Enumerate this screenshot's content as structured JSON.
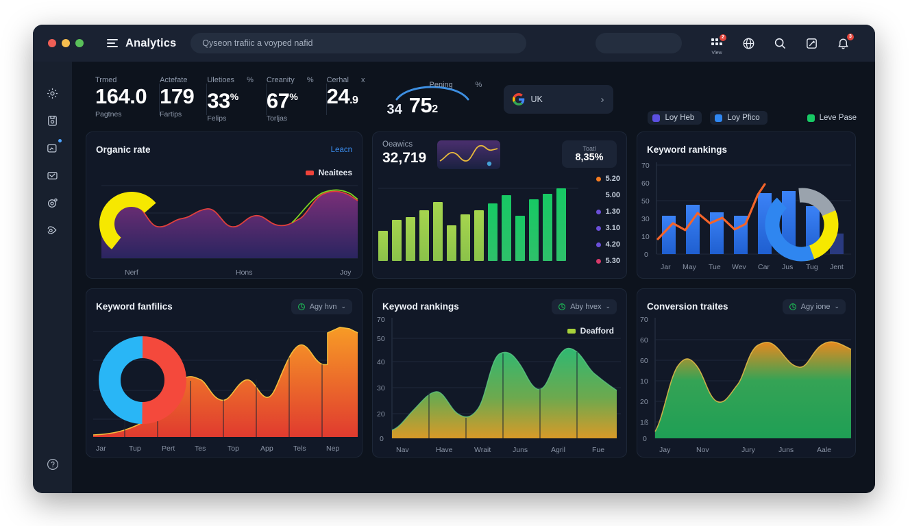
{
  "window": {
    "title": "Analytics",
    "traffic_lights": [
      "close",
      "minimize",
      "zoom"
    ],
    "omnibox_value": "Qyseon trafiic a voyped nafid",
    "toolbar_icons": [
      {
        "name": "apps-grid-icon",
        "caption": "Vlew",
        "badge": "2"
      },
      {
        "name": "globe-icon",
        "badge": ""
      },
      {
        "name": "search-icon",
        "badge": ""
      },
      {
        "name": "edit-square-icon",
        "badge": ""
      },
      {
        "name": "notifications-bell-icon",
        "badge": "3"
      }
    ]
  },
  "sidebar": {
    "items": [
      {
        "name": "settings-gear-icon",
        "label": "Settings"
      },
      {
        "name": "document-save-icon",
        "label": "Reports"
      },
      {
        "name": "chart-upload-icon",
        "label": "Insights"
      },
      {
        "name": "mail-check-icon",
        "label": "Inbox"
      },
      {
        "name": "target-add-icon",
        "label": "Goals"
      },
      {
        "name": "tag-icon",
        "label": "Tags"
      }
    ],
    "footer_item": {
      "name": "help-circle-icon",
      "label": "Help"
    }
  },
  "kpis": [
    {
      "top_label": "Trmed",
      "value": "164.0",
      "suffix": "",
      "sub_label": "Pagtnes"
    },
    {
      "top_label": "Actefate",
      "value": "179",
      "suffix": "",
      "sub_label": "Fartips"
    },
    {
      "top_label": "Uletioes",
      "unit": "%",
      "value": "33",
      "suffix": "%",
      "sub_label": "Felips"
    },
    {
      "top_label": "Creanity",
      "unit": "%",
      "value": "67",
      "suffix": "%",
      "sub_label": "Torljas"
    },
    {
      "top_label": "Cerhal",
      "unit": "x",
      "value": "24",
      "suffix": ".9",
      "sub_label": ""
    }
  ],
  "gauge": {
    "label": "Pening",
    "unit": "%",
    "small_value": "34",
    "big_value": "75",
    "big_suffix": "2",
    "arc_color": "#3d8ee0"
  },
  "provider_button": {
    "icon": "google-logo-icon",
    "label": "UK",
    "chevron": "›"
  },
  "kpi_legend": [
    {
      "label": "Loy Heb",
      "color": "#5b4fe0",
      "chip": true
    },
    {
      "label": "Loy Pfico",
      "color": "#2f86f0",
      "chip": true
    },
    {
      "label": "Leve Pase",
      "color": "#17c964",
      "chip": false
    }
  ],
  "cards": {
    "organic_rate": {
      "title": "Organic rate",
      "action": "Leacn",
      "legend": {
        "label": "Neaitees",
        "color": "#f0433a"
      },
      "donut_colors": [
        "#f6e800"
      ],
      "x_labels": [
        "Nerf",
        "Hons",
        "Joy"
      ]
    },
    "organics": {
      "kpi_label": "Oeawics",
      "kpi_value": "32,719",
      "pill_label": "Toatl",
      "pill_value": "8,35%",
      "legend": [
        {
          "label": "5.20",
          "color": "#f47b20"
        },
        {
          "label": "5.00",
          "color": "#00000000"
        },
        {
          "label": "1.30",
          "color": "#6b4fd8"
        },
        {
          "label": "3.10",
          "color": "#6b4fd8"
        },
        {
          "label": "4.20",
          "color": "#6b4fd8"
        },
        {
          "label": "5.30",
          "color": "#d83a6a"
        }
      ]
    },
    "keyword_rankings_top": {
      "title": "Keyword rankings",
      "y_ticks": [
        "70",
        "60",
        "50",
        "30",
        "10",
        "0"
      ],
      "x_labels": [
        "Jar",
        "May",
        "Tue",
        "Wev",
        "Car",
        "Jus",
        "Tug",
        "Jent"
      ]
    },
    "keyword_fanfuics": {
      "title": "Keyword fanfilics",
      "selector": {
        "label": "Agy hvn",
        "icon": "globe-icon",
        "chevron": "⌄"
      },
      "x_labels": [
        "Jar",
        "Tup",
        "Pert",
        "Tes",
        "Top",
        "App",
        "Tels",
        "Nep"
      ],
      "donut_colors": [
        "#29b6f6",
        "#f4493c"
      ]
    },
    "keyword_rankings_bottom": {
      "title": "Keywod rankings",
      "selector": {
        "label": "Aby hvex",
        "icon": "globe-icon",
        "chevron": "⌄"
      },
      "legend": {
        "label": "Deafford",
        "color": "#a7d13a"
      },
      "y_ticks": [
        "70",
        "50",
        "40",
        "30",
        "20",
        "0"
      ],
      "x_labels": [
        "Nav",
        "Have",
        "Wrait",
        "Juns",
        "Agril",
        "Fue"
      ]
    },
    "conversion_traites": {
      "title": "Conversion traites",
      "selector": {
        "label": "Agy ione",
        "icon": "globe-icon",
        "chevron": "⌄"
      },
      "y_ticks": [
        "70",
        "60",
        "60",
        "10",
        "20",
        "1ß",
        "0"
      ],
      "x_labels": [
        "Jay",
        "Nov",
        "Jury",
        "Juns",
        "Aale"
      ]
    }
  },
  "chart_data": [
    {
      "type": "area",
      "title": "Organic rate",
      "series": [
        {
          "name": "Neaitees",
          "color": "#f0433a",
          "values": [
            30,
            52,
            38,
            33,
            47,
            36,
            55,
            35,
            31,
            44,
            33,
            42,
            36,
            34,
            70,
            78,
            74,
            66
          ]
        }
      ],
      "categories": [
        "Nerf",
        "Hons",
        "Joy"
      ],
      "grid": true,
      "legend": "top-right",
      "overlay": {
        "type": "donut",
        "colors": [
          "#f6e800"
        ],
        "values": [
          100
        ]
      }
    },
    {
      "type": "bar",
      "title": "Oeawics",
      "categories": [
        "1",
        "2",
        "3",
        "4",
        "5",
        "6",
        "7",
        "8",
        "9",
        "10",
        "11",
        "12",
        "13",
        "14"
      ],
      "values": [
        28,
        40,
        44,
        52,
        62,
        34,
        46,
        50,
        60,
        72,
        44,
        62,
        70,
        80
      ],
      "ylim": [
        0,
        100
      ],
      "color_from": "#8bc24a",
      "color_to": "#17c964"
    },
    {
      "type": "bar",
      "title": "Keyword rankings",
      "categories": [
        "Jar",
        "May",
        "Tue",
        "Wev",
        "Car",
        "Jus",
        "Tug",
        "Jent"
      ],
      "values": [
        26,
        34,
        28,
        26,
        44,
        46,
        32,
        16
      ],
      "ylim": [
        0,
        70
      ],
      "ylabel": "",
      "xlabel": "",
      "series": [
        {
          "name": "bars",
          "color": "#2f6fe0",
          "values": [
            26,
            34,
            28,
            26,
            44,
            46,
            32,
            16
          ]
        },
        {
          "name": "trend",
          "color": "#f4642a",
          "values": [
            12,
            30,
            22,
            36,
            26,
            33,
            22,
            58,
            63
          ]
        }
      ],
      "overlay": {
        "type": "donut",
        "colors": [
          "#9aa3ad",
          "#f6e800",
          "#2f86f0"
        ],
        "values": [
          22,
          30,
          48
        ]
      }
    },
    {
      "type": "area",
      "title": "Keyword fanfilics",
      "categories": [
        "Jar",
        "Tup",
        "Pert",
        "Tes",
        "Top",
        "App",
        "Tels",
        "Nep"
      ],
      "values": [
        2,
        6,
        18,
        44,
        40,
        26,
        44,
        28,
        62,
        55,
        86,
        80
      ],
      "color_from": "#f79b26",
      "color_to": "#e03b2f",
      "overlay": {
        "type": "donut",
        "colors": [
          "#29b6f6",
          "#f4493c"
        ],
        "values": [
          50,
          50
        ]
      }
    },
    {
      "type": "area",
      "title": "Keywod rankings",
      "categories": [
        "Nav",
        "Have",
        "Wrait",
        "Juns",
        "Agril",
        "Fue"
      ],
      "values": [
        5,
        14,
        31,
        24,
        16,
        48,
        50,
        36,
        30,
        47,
        46,
        28
      ],
      "ylim": [
        0,
        70
      ],
      "series": [
        {
          "name": "Deafford",
          "color": "#a7d13a"
        }
      ],
      "color_from": "#2fb872",
      "color_to": "#d99a28"
    },
    {
      "type": "area",
      "title": "Conversion traites",
      "categories": [
        "Jay",
        "Nov",
        "Jury",
        "Juns",
        "Aale"
      ],
      "values": [
        10,
        32,
        50,
        42,
        30,
        36,
        58,
        56,
        40,
        56,
        58,
        56
      ],
      "ylim": [
        0,
        70
      ],
      "color_from": "#22a75a",
      "color_to": "#e8891f"
    }
  ]
}
